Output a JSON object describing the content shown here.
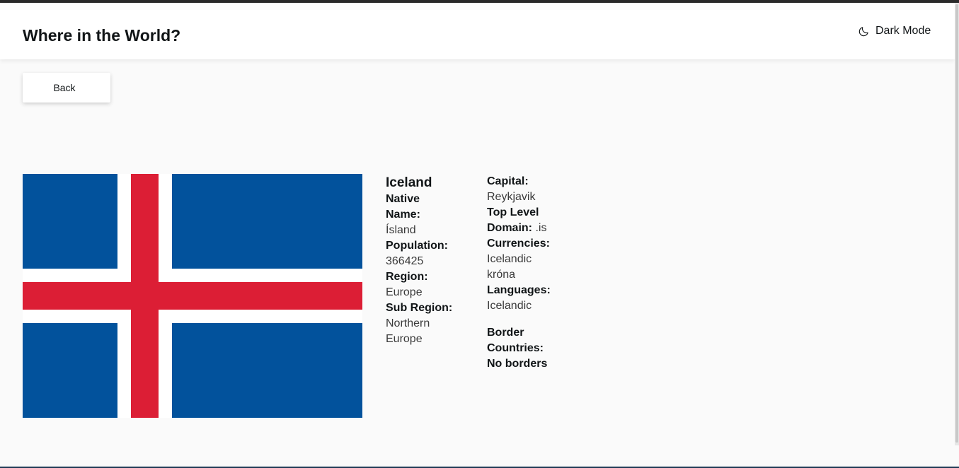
{
  "header": {
    "title": "Where in the World?",
    "dark_mode_label": "Dark Mode",
    "dark_mode_icon": "moon-icon"
  },
  "back_label": "Back",
  "flag": {
    "icon": "flag-of-iceland",
    "colors": {
      "field": "#02529c",
      "outer_cross": "#ffffff",
      "inner_cross": "#dc1e35"
    }
  },
  "country": {
    "name": "Iceland",
    "native_name_label_1": "Native",
    "native_name_label_2": "Name:",
    "native_name": "Ísland",
    "population_label": "Population:",
    "population": "366425",
    "region_label": "Region:",
    "region": "Europe",
    "sub_region_label": "Sub Region:",
    "sub_region_1": "Northern",
    "sub_region_2": "Europe",
    "capital_label": "Capital:",
    "capital": "Reykjavik",
    "tld_label_1": "Top Level",
    "tld_label_2": "Domain:",
    "tld": ".is",
    "currencies_label": "Currencies:",
    "currency_1": "Icelandic",
    "currency_2": "króna",
    "languages_label": "Languages:",
    "language": "Icelandic",
    "border_label_1": "Border",
    "border_label_2": "Countries:",
    "border_value": "No borders"
  }
}
